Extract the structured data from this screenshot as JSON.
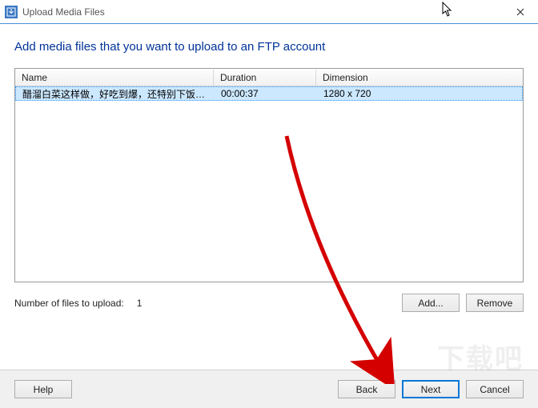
{
  "window": {
    "title": "Upload Media Files"
  },
  "heading": "Add media files that you want to upload to an FTP account",
  "table": {
    "headers": {
      "name": "Name",
      "duration": "Duration",
      "dimension": "Dimension"
    },
    "rows": [
      {
        "name": "醋溜白菜这样做，好吃到爆，还特别下饭，...",
        "duration": "00:00:37",
        "dimension": "1280 x 720"
      }
    ]
  },
  "status": {
    "label": "Number of files to upload:",
    "count": "1"
  },
  "buttons": {
    "add": "Add...",
    "remove": "Remove",
    "help": "Help",
    "back": "Back",
    "next": "Next",
    "cancel": "Cancel"
  },
  "watermark": "下载吧"
}
